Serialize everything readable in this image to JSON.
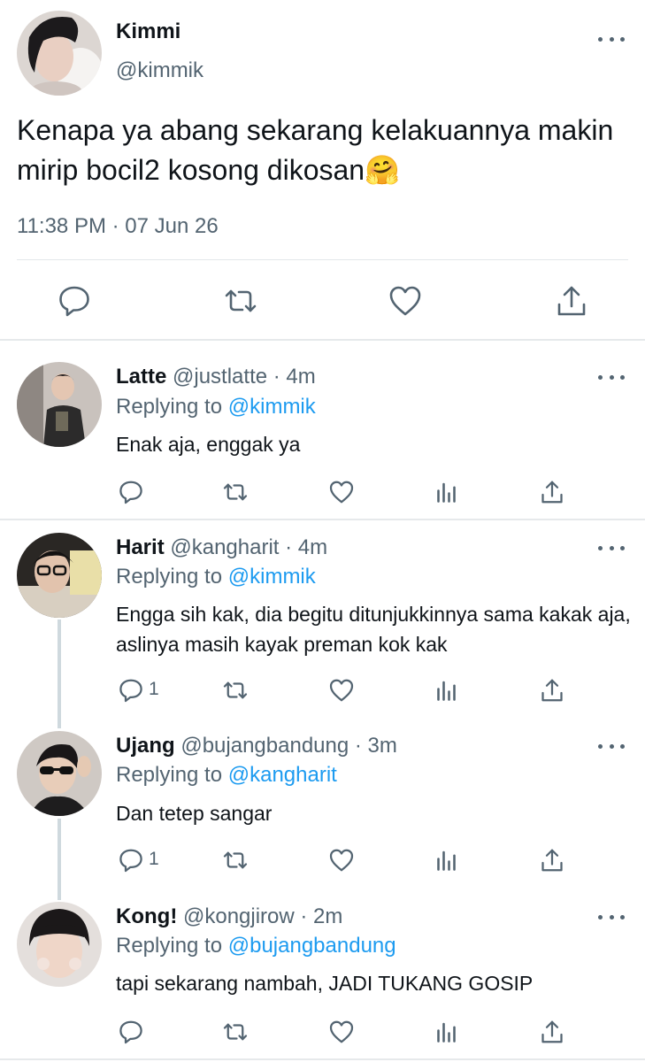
{
  "main_tweet": {
    "author_name": "Kimmi",
    "author_handle": "@kimmik",
    "text": "Kenapa ya abang sekarang kelakuannya makin mirip bocil2 kosong dikosan🤗",
    "timestamp": "11:38 PM · 07 Jun 26",
    "actions": [
      "reply-icon",
      "retweet-icon",
      "like-icon",
      "share-icon"
    ]
  },
  "replies": [
    {
      "name": "Latte",
      "handle": "@justlatte · 4m",
      "replying_prefix": "Replying to ",
      "replying_to": "@kimmik",
      "text": "Enak aja, enggak ya",
      "reply_count": ""
    },
    {
      "name": "Harit",
      "handle": "@kangharit · 4m",
      "replying_prefix": "Replying to ",
      "replying_to": "@kimmik",
      "text": "Engga sih kak, dia begitu ditunjukkinnya sama kakak aja, aslinya masih kayak preman kok kak",
      "reply_count": "1"
    },
    {
      "name": "Ujang",
      "handle": "@bujangbandung · 3m",
      "replying_prefix": "Replying to ",
      "replying_to": "@kangharit",
      "text": "Dan tetep sangar",
      "reply_count": "1"
    },
    {
      "name": "Kong!",
      "handle": "@kongjirow · 2m",
      "replying_prefix": "Replying to ",
      "replying_to": "@bujangbandung",
      "text": "tapi sekarang nambah, JADI TUKANG GOSIP",
      "reply_count": ""
    }
  ],
  "colors": {
    "text": "#0f1419",
    "secondary": "#536471",
    "link": "#1d9bf0",
    "divider": "#e6e9eb",
    "thread_line": "#cfd9de"
  }
}
